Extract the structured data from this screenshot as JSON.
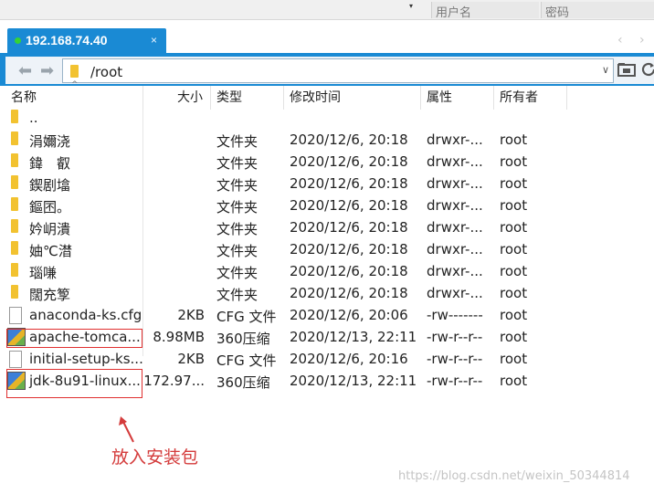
{
  "topbar": {
    "dropdown_glyph": "▾",
    "username_placeholder": "用户名",
    "password_placeholder": "密码"
  },
  "tab": {
    "title": "192.168.74.40",
    "close": "×",
    "status_color": "#36d236",
    "nav_prev": "‹",
    "nav_next": "›"
  },
  "address": {
    "back_icon": "arrow-left-icon",
    "forward_icon": "arrow-right-icon",
    "path": "/root",
    "dropdown": "∨"
  },
  "columns": {
    "name": "名称",
    "size": "大小",
    "type": "类型",
    "modified": "修改时间",
    "attrs": "属性",
    "owner": "所有者",
    "sort_indicator": "^"
  },
  "rows": [
    {
      "icon": "folder",
      "name": "..",
      "size": "",
      "type": "",
      "modified": "",
      "attrs": "",
      "owner": ""
    },
    {
      "icon": "folder",
      "name": "涓嬭浇",
      "size": "",
      "type": "文件夹",
      "modified": "2020/12/6, 20:18",
      "attrs": "drwxr-...",
      "owner": "root"
    },
    {
      "icon": "folder",
      "name": "鍏　叡",
      "size": "",
      "type": "文件夹",
      "modified": "2020/12/6, 20:18",
      "attrs": "drwxr-...",
      "owner": "root"
    },
    {
      "icon": "folder",
      "name": "鍥剧墖",
      "size": "",
      "type": "文件夹",
      "modified": "2020/12/6, 20:18",
      "attrs": "drwxr-...",
      "owner": "root"
    },
    {
      "icon": "folder",
      "name": "鏂囨。",
      "size": "",
      "type": "文件夹",
      "modified": "2020/12/6, 20:18",
      "attrs": "drwxr-...",
      "owner": "root"
    },
    {
      "icon": "folder",
      "name": "妗岄潰",
      "size": "",
      "type": "文件夹",
      "modified": "2020/12/6, 20:18",
      "attrs": "drwxr-...",
      "owner": "root"
    },
    {
      "icon": "folder",
      "name": "妯℃澘",
      "size": "",
      "type": "文件夹",
      "modified": "2020/12/6, 20:18",
      "attrs": "drwxr-...",
      "owner": "root"
    },
    {
      "icon": "folder",
      "name": "瑙嗛",
      "size": "",
      "type": "文件夹",
      "modified": "2020/12/6, 20:18",
      "attrs": "drwxr-...",
      "owner": "root"
    },
    {
      "icon": "folder",
      "name": "闊充箰",
      "size": "",
      "type": "文件夹",
      "modified": "2020/12/6, 20:18",
      "attrs": "drwxr-...",
      "owner": "root"
    },
    {
      "icon": "file",
      "name": "anaconda-ks.cfg",
      "size": "2KB",
      "type": "CFG 文件",
      "modified": "2020/12/6, 20:06",
      "attrs": "-rw-------",
      "owner": "root"
    },
    {
      "icon": "zip",
      "name": "apache-tomca...",
      "size": "8.98MB",
      "type": "360压缩",
      "modified": "2020/12/13, 22:11",
      "attrs": "-rw-r--r--",
      "owner": "root"
    },
    {
      "icon": "file",
      "name": "initial-setup-ks...",
      "size": "2KB",
      "type": "CFG 文件",
      "modified": "2020/12/6, 20:16",
      "attrs": "-rw-r--r--",
      "owner": "root"
    },
    {
      "icon": "zip",
      "name": "jdk-8u91-linux...",
      "size": "172.97...",
      "type": "360压缩",
      "modified": "2020/12/13, 22:11",
      "attrs": "-rw-r--r--",
      "owner": "root"
    }
  ],
  "annotation": {
    "text": "放入安装包",
    "color": "#d43b3b"
  },
  "watermark": "https://blog.csdn.net/weixin_50344814"
}
